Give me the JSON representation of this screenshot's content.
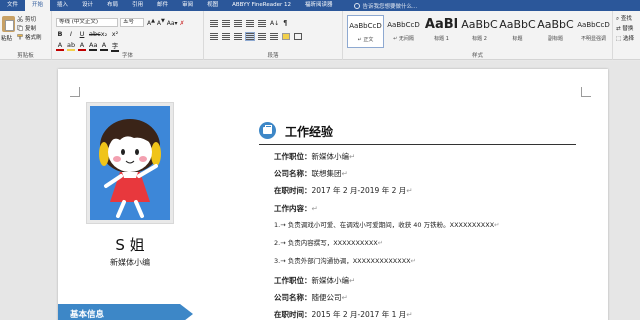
{
  "menubar": {
    "tabs": [
      "文件",
      "开始",
      "插入",
      "设计",
      "布局",
      "引用",
      "邮件",
      "审阅",
      "视图",
      "ABBYY FineReader 12",
      "福昕阅读器"
    ],
    "active_tab": "开始",
    "search_placeholder": "告诉我您想要做什么...",
    "colors": {
      "bar": "#2b579a",
      "active_bg": "#f3f3f3"
    }
  },
  "ribbon": {
    "clipboard": {
      "label": "剪贴板",
      "paste": "粘贴",
      "cut": "剪切",
      "copy": "复制",
      "format_painter": "格式刷"
    },
    "font": {
      "label": "字体",
      "font_name": "等线 (中文正文)",
      "font_size": "五号",
      "buttons": [
        "B",
        "I",
        "U",
        "abc",
        "x₂",
        "x²"
      ],
      "buttons2": [
        "A",
        "ab",
        "A",
        "Aa",
        "A",
        "字"
      ]
    },
    "paragraph": {
      "label": "段落"
    },
    "styles": {
      "label": "样式",
      "items": [
        {
          "sample": "AaBbCcD",
          "name": "↵ 正文",
          "selected": true,
          "size": 7
        },
        {
          "sample": "AaBbCcD",
          "name": "↵ 无间隔",
          "selected": false,
          "size": 7
        },
        {
          "sample": "AaBl",
          "name": "标题 1",
          "selected": false,
          "size": 13
        },
        {
          "sample": "AaBbC",
          "name": "标题 2",
          "selected": false,
          "size": 11
        },
        {
          "sample": "AaBbC",
          "name": "标题",
          "selected": false,
          "size": 11
        },
        {
          "sample": "AaBbC",
          "name": "副标题",
          "selected": false,
          "size": 11
        },
        {
          "sample": "AaBbCcD",
          "name": "不明显强调",
          "selected": false,
          "size": 7
        }
      ]
    },
    "editing": {
      "find": "查找",
      "replace": "替换",
      "select": "选择"
    }
  },
  "resume": {
    "name": "S 姐",
    "role": "新媒体小编",
    "left_section": "基本信息",
    "section_color": "#3d87c7",
    "experience_title": "工作经验",
    "lines": [
      {
        "label": "工作职位：",
        "value": "新媒体小编"
      },
      {
        "label": "公司名称：",
        "value": "联想集团"
      },
      {
        "label": "在职时间：",
        "value": "2017 年 2 月-2019 年 2 月"
      },
      {
        "label": "工作内容：",
        "value": ""
      },
      {
        "label": "",
        "value": "1.→ 负责调戏小可爱、在调戏小可爱期间，收获 40 万铁粉。XXXXXXXXXX"
      },
      {
        "label": "",
        "value": "2.→ 负责内容撰写，XXXXXXXXXX"
      },
      {
        "label": "",
        "value": "3.→ 负责外部门沟通协调，XXXXXXXXXXXXX"
      },
      {
        "label": "工作职位：",
        "value": "新媒体小编"
      },
      {
        "label": "公司名称：",
        "value": "随便公司"
      },
      {
        "label": "在职时间：",
        "value": "2015 年 2 月-2017 年 1 月"
      }
    ]
  }
}
